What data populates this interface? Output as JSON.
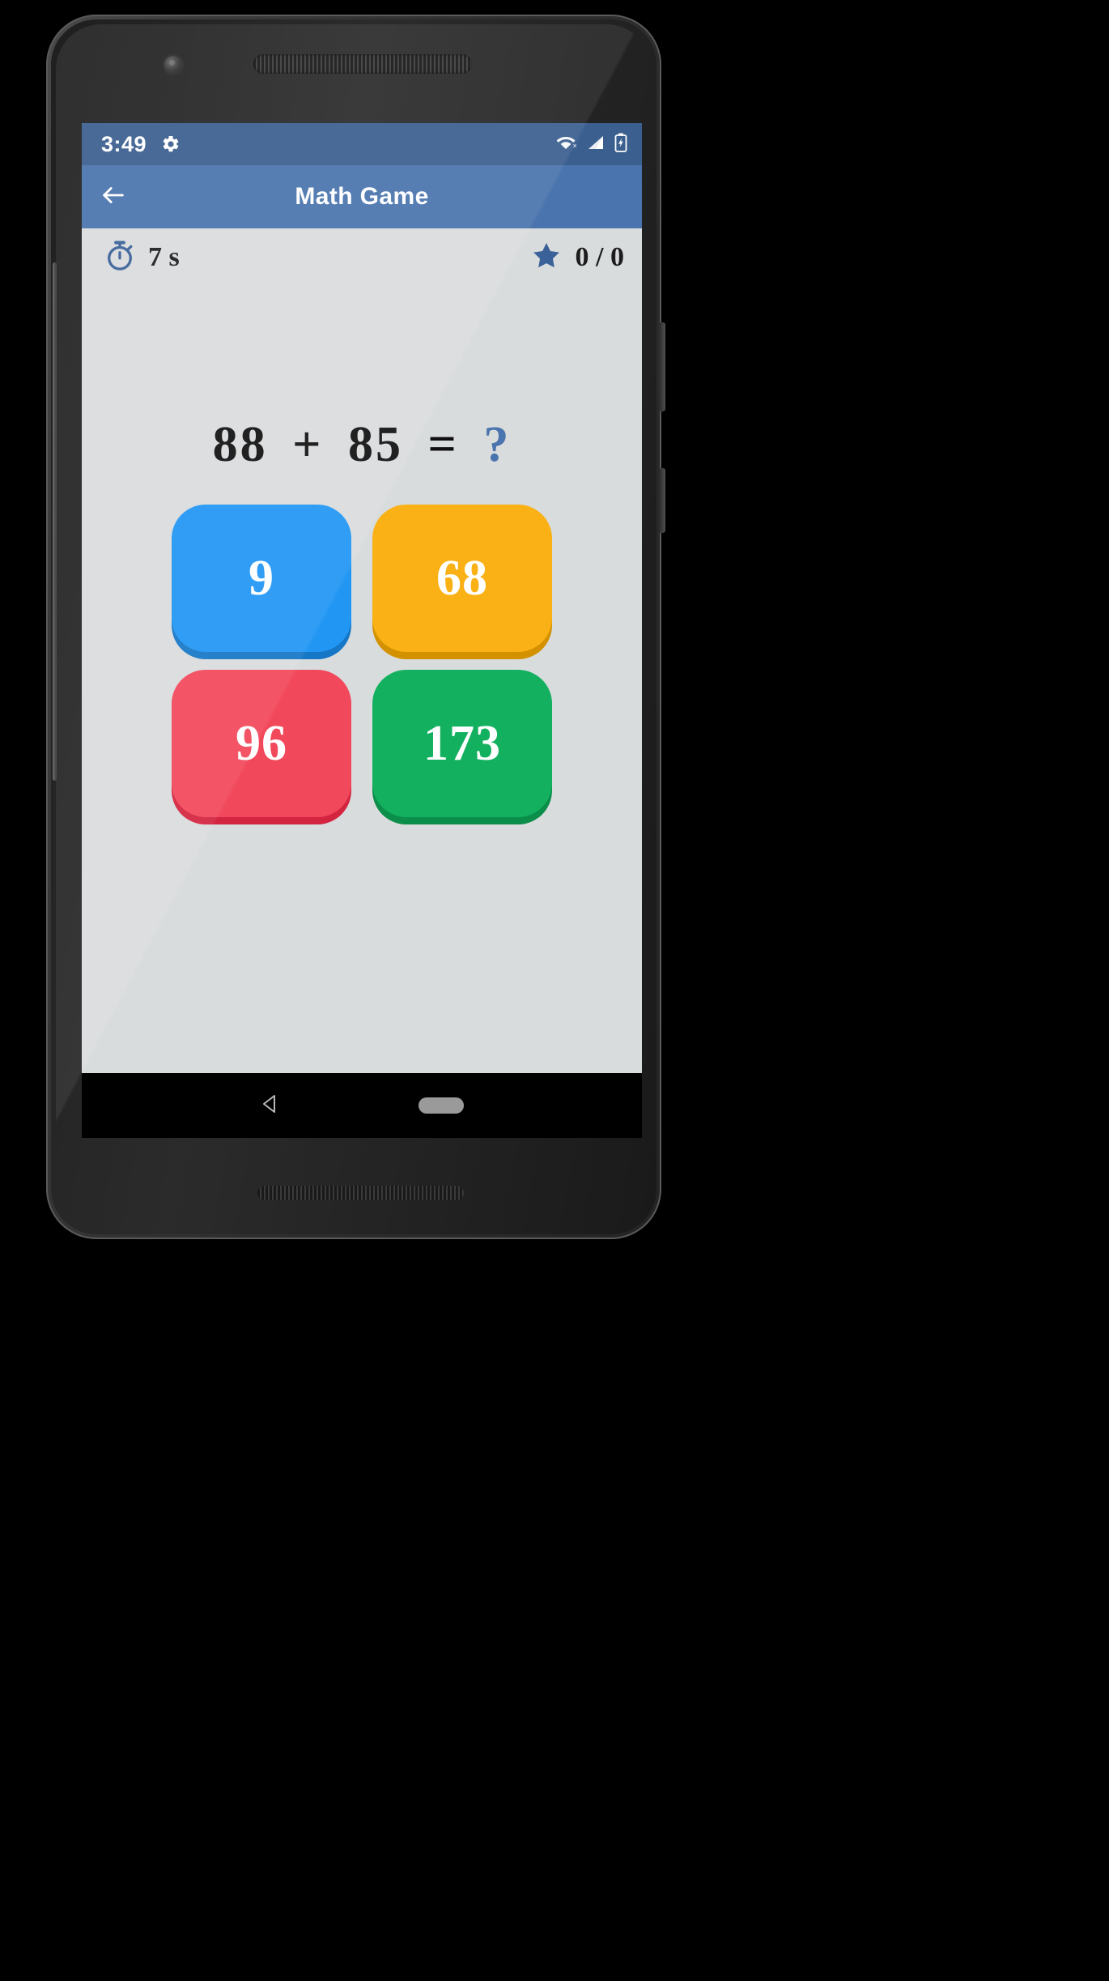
{
  "status_bar": {
    "time": "3:49",
    "gear_icon": "gear-icon",
    "wifi_icon": "wifi-off-icon",
    "signal_icon": "cellular-signal-icon",
    "battery_icon": "battery-charging-icon",
    "background": "#3b5f8f"
  },
  "app_bar": {
    "back_icon": "back-arrow-icon",
    "title": "Math Game",
    "background": "#4a74ad"
  },
  "hud": {
    "timer_icon": "stopwatch-icon",
    "timer_value": "7 s",
    "star_icon": "star-icon",
    "score_value": "0 / 0",
    "accent": "#3b6199"
  },
  "game": {
    "equation": {
      "operand_left": "88",
      "operator": "+",
      "operand_right": "85",
      "equals": "=",
      "unknown": "?",
      "full_text": "88 + 85 = ?",
      "unknown_color": "#4a74ad"
    },
    "answers": [
      {
        "label": "9",
        "color": "#2196f3",
        "shadow": "#1577c6",
        "name": "answer-tile-9"
      },
      {
        "label": "68",
        "color": "#f9b115",
        "shadow": "#d39100",
        "name": "answer-tile-68"
      },
      {
        "label": "96",
        "color": "#f2485b",
        "shadow": "#d32440",
        "name": "answer-tile-96"
      },
      {
        "label": "173",
        "color": "#12b05f",
        "shadow": "#0a8e4a",
        "name": "answer-tile-173"
      }
    ],
    "background": "#d9dcdd"
  },
  "nav_bar": {
    "back_icon": "nav-back-triangle-icon",
    "home_icon": "nav-home-pill-icon",
    "background": "#000000"
  }
}
